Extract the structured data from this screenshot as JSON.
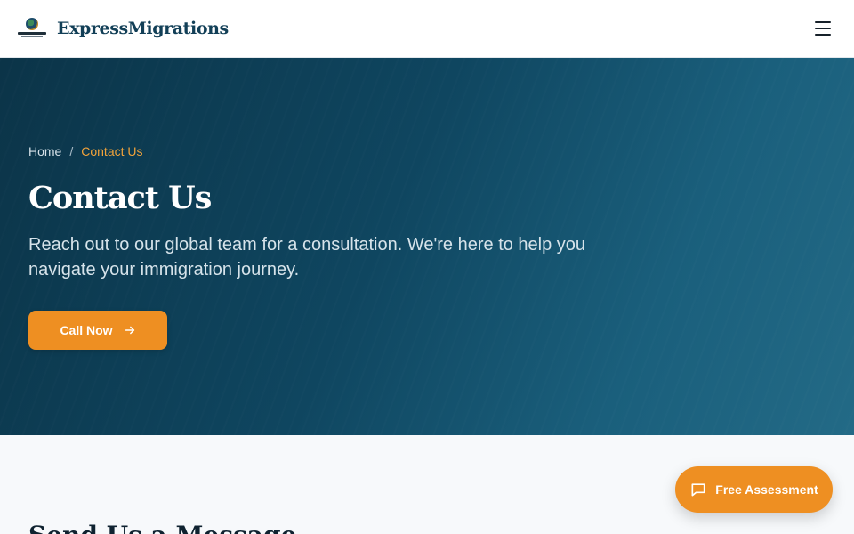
{
  "header": {
    "brand": "ExpressMigrations",
    "menu_icon": "hamburger-menu-icon"
  },
  "hero": {
    "breadcrumb": {
      "home": "Home",
      "separator": "/",
      "current": "Contact Us"
    },
    "title": "Contact Us",
    "subtitle": "Reach out to our global team for a consultation. We're here to help you navigate your immigration journey.",
    "cta_label": "Call Now",
    "cta_icon": "arrow-right-icon"
  },
  "section": {
    "title": "Send Us a Message"
  },
  "fab": {
    "label": "Free Assessment",
    "icon": "chat-bubble-icon"
  },
  "colors": {
    "accent": "#ee8f22",
    "hero_dark": "#0b3448",
    "hero_light": "#236a86",
    "brand_text": "#123f57"
  }
}
